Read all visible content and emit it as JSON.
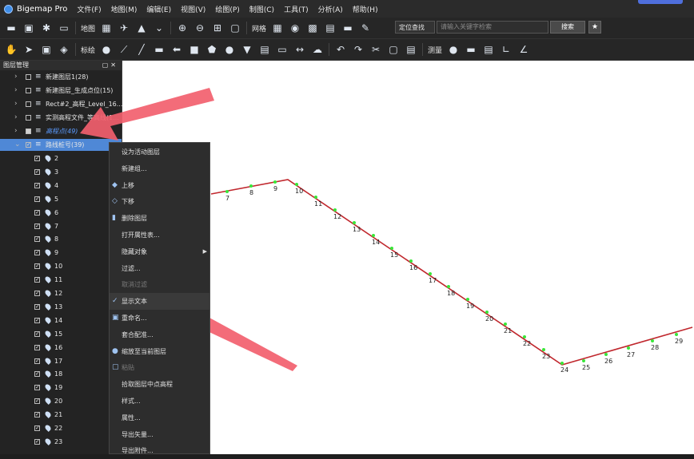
{
  "app": {
    "title": "Bigemap Pro"
  },
  "menu": [
    "文件(F)",
    "地图(M)",
    "编辑(E)",
    "视图(V)",
    "绘图(P)",
    "制图(C)",
    "工具(T)",
    "分析(A)",
    "帮助(H)"
  ],
  "toolbar1": {
    "map_label": "地图",
    "grid_label": "网格",
    "locate_label": "定位查找",
    "search_placeholder": "请输入关键字检索",
    "search_button": "搜索"
  },
  "toolbar2": {
    "annotate_label": "标绘",
    "measure_label": "测量"
  },
  "layer_panel": {
    "title": "图层管理",
    "layers": [
      {
        "name": "新建图层1(28)",
        "state": "off"
      },
      {
        "name": "新建图层_生成点位(15)",
        "state": "off"
      },
      {
        "name": "Rect#2_高程_Level_16...",
        "state": "off"
      },
      {
        "name": "实测高程文件_等高线(1...",
        "state": "off"
      },
      {
        "name": "高程点(49)",
        "state": "partial"
      },
      {
        "name": "路线桩号(39)",
        "state": "on"
      }
    ],
    "points": [
      "2",
      "3",
      "4",
      "5",
      "6",
      "7",
      "8",
      "9",
      "10",
      "11",
      "12",
      "13",
      "14",
      "15",
      "16",
      "17",
      "18",
      "19",
      "20",
      "21",
      "22",
      "23"
    ]
  },
  "context_menu": [
    {
      "label": "设为活动图层",
      "icon": "",
      "disabled": false
    },
    {
      "label": "新建组...",
      "icon": "",
      "disabled": false
    },
    {
      "label": "上移",
      "icon": "layer-up-icon",
      "disabled": false
    },
    {
      "label": "下移",
      "icon": "layer-down-icon",
      "disabled": false
    },
    {
      "label": "删除图层",
      "icon": "delete-icon",
      "disabled": false
    },
    {
      "label": "打开属性表...",
      "icon": "",
      "disabled": false
    },
    {
      "label": "隐藏对象",
      "icon": "",
      "disabled": false,
      "submenu": true
    },
    {
      "label": "过滤...",
      "icon": "",
      "disabled": false
    },
    {
      "label": "取消过滤",
      "icon": "",
      "disabled": true
    },
    {
      "label": "显示文本",
      "icon": "check-icon",
      "disabled": false,
      "highlighted": true
    },
    {
      "label": "重命名...",
      "icon": "rename-icon",
      "disabled": false
    },
    {
      "label": "套合配准...",
      "icon": "",
      "disabled": false
    },
    {
      "label": "缩放至当前图层",
      "icon": "zoom-layer-icon",
      "disabled": false
    },
    {
      "label": "粘贴",
      "icon": "paste-icon",
      "disabled": true
    },
    {
      "label": "拾取图层中点高程",
      "icon": "",
      "disabled": false
    },
    {
      "label": "样式...",
      "icon": "",
      "disabled": false
    },
    {
      "label": "属性...",
      "icon": "",
      "disabled": false
    },
    {
      "label": "导出矢量...",
      "icon": "",
      "disabled": false
    },
    {
      "label": "导出附件...",
      "icon": "",
      "disabled": false
    }
  ],
  "map": {
    "route_color": "#c0272d",
    "point_color": "#39e639",
    "stations": [
      "7",
      "8",
      "9",
      "10",
      "11",
      "12",
      "13",
      "14",
      "15",
      "16",
      "17",
      "18",
      "19",
      "20",
      "21",
      "22",
      "23",
      "24",
      "25",
      "26",
      "27",
      "28",
      "29"
    ]
  },
  "annotation_color": "#f2606e"
}
